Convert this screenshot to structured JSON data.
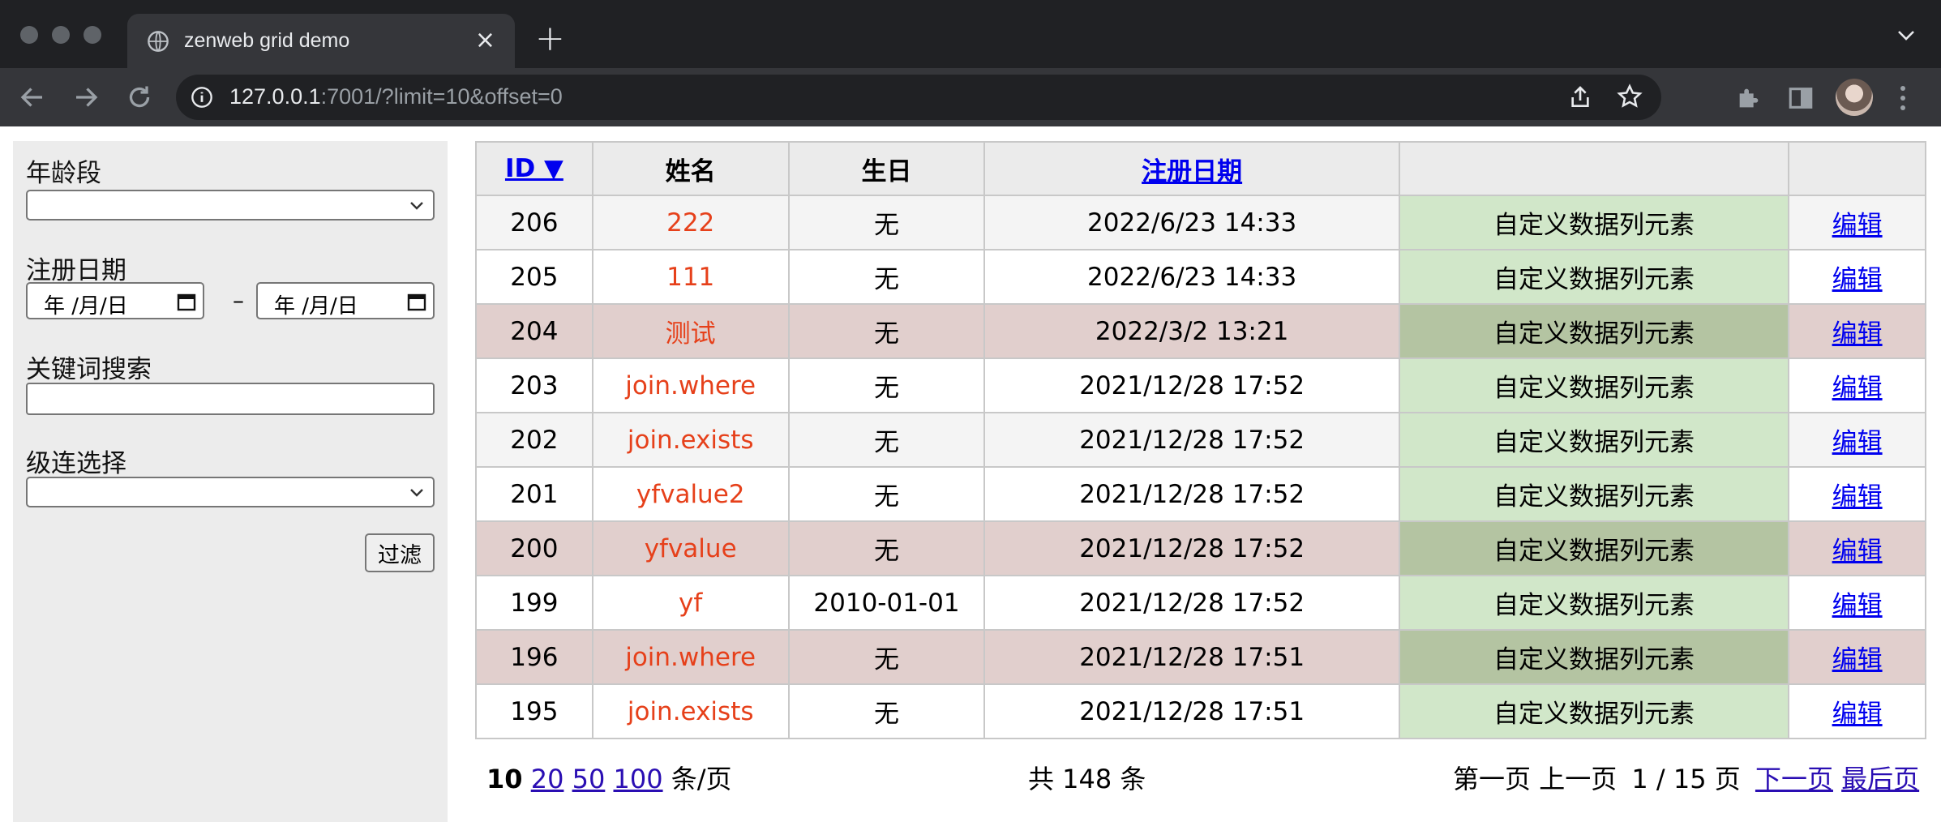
{
  "browser": {
    "tab_title": "zenweb grid demo",
    "tab_close": "×",
    "new_tab": "+",
    "url_host": "127.0.0.1",
    "url_rest": ":7001/?limit=10&offset=0"
  },
  "filter": {
    "age_label": "年龄段",
    "age_value": "",
    "reg_label": "注册日期",
    "date_from": "年 /月/日",
    "date_sep": "–",
    "date_to": "年 /月/日",
    "keyword_label": "关键词搜索",
    "keyword_value": "",
    "cascade_label": "级连选择",
    "cascade_value": "",
    "submit": "过滤"
  },
  "grid": {
    "headers": {
      "id": "ID ▼",
      "name": "姓名",
      "birthday": "生日",
      "reg_date": "注册日期",
      "custom": "",
      "action": ""
    },
    "rows": [
      {
        "id": "206",
        "name": "222",
        "birthday": "无",
        "reg_date": "2022/6/23 14:33",
        "custom": "自定义数据列元素",
        "action": "编辑"
      },
      {
        "id": "205",
        "name": "111",
        "birthday": "无",
        "reg_date": "2022/6/23 14:33",
        "custom": "自定义数据列元素",
        "action": "编辑"
      },
      {
        "id": "204",
        "name": "测试",
        "birthday": "无",
        "reg_date": "2022/3/2 13:21",
        "custom": "自定义数据列元素",
        "action": "编辑"
      },
      {
        "id": "203",
        "name": "join.where",
        "birthday": "无",
        "reg_date": "2021/12/28 17:52",
        "custom": "自定义数据列元素",
        "action": "编辑"
      },
      {
        "id": "202",
        "name": "join.exists",
        "birthday": "无",
        "reg_date": "2021/12/28 17:52",
        "custom": "自定义数据列元素",
        "action": "编辑"
      },
      {
        "id": "201",
        "name": "yfvalue2",
        "birthday": "无",
        "reg_date": "2021/12/28 17:52",
        "custom": "自定义数据列元素",
        "action": "编辑"
      },
      {
        "id": "200",
        "name": "yfvalue",
        "birthday": "无",
        "reg_date": "2021/12/28 17:52",
        "custom": "自定义数据列元素",
        "action": "编辑"
      },
      {
        "id": "199",
        "name": "yf",
        "birthday": "2010-01-01",
        "reg_date": "2021/12/28 17:52",
        "custom": "自定义数据列元素",
        "action": "编辑"
      },
      {
        "id": "196",
        "name": "join.where",
        "birthday": "无",
        "reg_date": "2021/12/28 17:51",
        "custom": "自定义数据列元素",
        "action": "编辑"
      },
      {
        "id": "195",
        "name": "join.exists",
        "birthday": "无",
        "reg_date": "2021/12/28 17:51",
        "custom": "自定义数据列元素",
        "action": "编辑"
      }
    ]
  },
  "pager": {
    "size_current": "10",
    "size_20": "20",
    "size_50": "50",
    "size_100": "100",
    "per_page": "条/页",
    "total": "共 148 条",
    "first": "第一页",
    "prev": "上一页",
    "current": "1 / 15 页",
    "next": "下一页",
    "last": "最后页"
  },
  "colors": {
    "name_text": "#e6401a",
    "link": "#0000ee",
    "custom_cell": "#d1e7c9",
    "highlight_row": "#e1cfcd"
  }
}
